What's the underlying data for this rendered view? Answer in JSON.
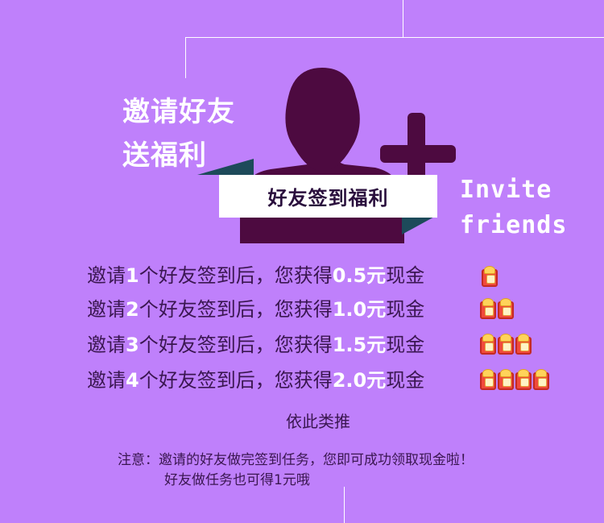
{
  "hero": {
    "title_line1": "邀请好友",
    "title_line2": "送福利",
    "banner": "好友签到福利",
    "english_line1": "Invite",
    "english_line2": "friends"
  },
  "rules": [
    {
      "prefix": "邀请",
      "count": "1",
      "middle": "个好友签到后，您获得",
      "amount": "0.5元",
      "suffix": "现金",
      "packs": 1
    },
    {
      "prefix": "邀请",
      "count": "2",
      "middle": "个好友签到后，您获得",
      "amount": "1.0元",
      "suffix": "现金",
      "packs": 2
    },
    {
      "prefix": "邀请",
      "count": "3",
      "middle": "个好友签到后，您获得",
      "amount": "1.5元",
      "suffix": "现金",
      "packs": 3
    },
    {
      "prefix": "邀请",
      "count": "4",
      "middle": "个好友签到后，您获得",
      "amount": "2.0元",
      "suffix": "现金",
      "packs": 4
    }
  ],
  "etc": "依此类推",
  "notes": {
    "line1": "注意：邀请的好友做完签到任务，您即可成功领取现金啦！",
    "line2": "好友做任务也可得1元哦"
  },
  "colors": {
    "background": "#bf80fb",
    "silhouette": "#4d0a40",
    "ribbon_dark": "#1d4a5a",
    "text_dark": "#3a1650",
    "highlight": "#ffffff",
    "red_packet": "#f04a3c"
  },
  "icons": {
    "avatar": "user-silhouette-icon",
    "plus": "plus-icon",
    "packet": "red-envelope-icon"
  }
}
